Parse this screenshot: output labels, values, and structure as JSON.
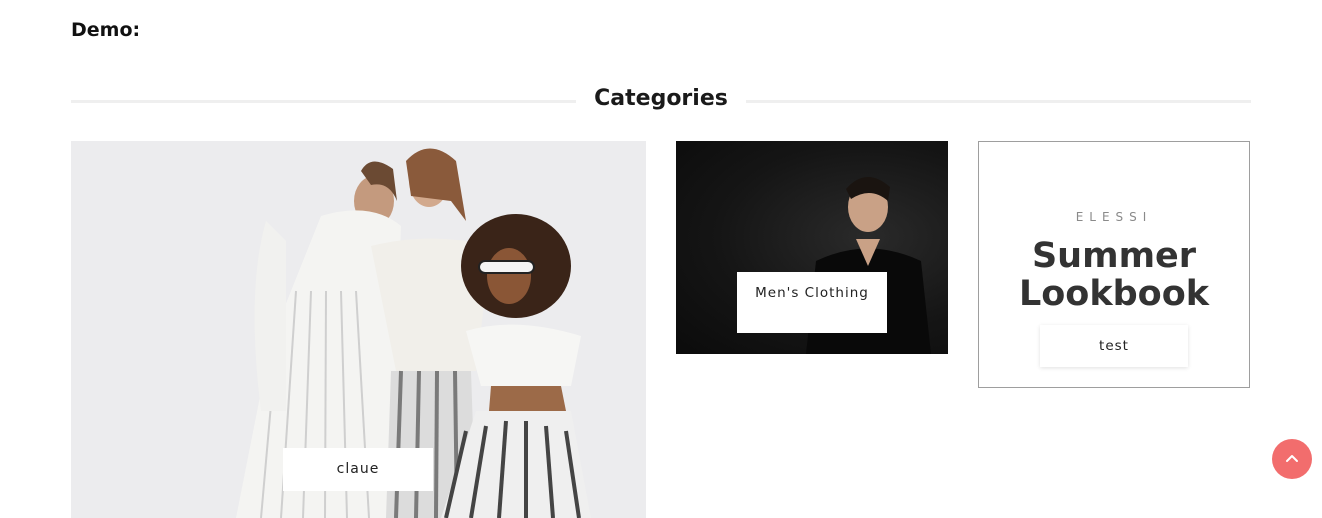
{
  "demo_label": "Demo:",
  "section": {
    "title": "Categories"
  },
  "cards": [
    {
      "label": "claue",
      "image": "women-group-photo"
    },
    {
      "label": "Men's Clothing",
      "image": "man-black-sweater-photo"
    },
    {
      "label": "test",
      "brand": "ELESSI",
      "title_line1": "Summer",
      "title_line2": "Lookbook"
    }
  ],
  "colors": {
    "accent": "#f26d6d",
    "divider": "#efefef",
    "text": "#222222"
  },
  "icons": {
    "scroll_top": "chevron-up-icon"
  }
}
